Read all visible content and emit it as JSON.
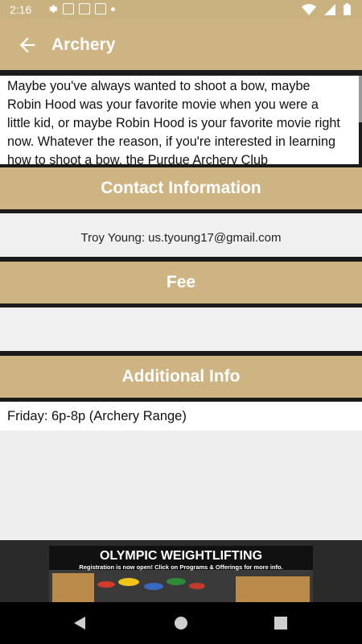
{
  "status_bar": {
    "time": "2:16"
  },
  "app_bar": {
    "title": "Archery",
    "back_icon": "arrow-left-icon"
  },
  "description": "Maybe you've always wanted to shoot a bow, maybe Robin Hood was your favorite movie when you were a little kid, or maybe Robin Hood is your favorite movie right now. Whatever the reason, if you're interested in learning how to shoot a bow, the Purdue Archery Club",
  "sections": {
    "contact": {
      "title": "Contact Information",
      "value": "Troy Young: us.tyoung17@gmail.com"
    },
    "fee": {
      "title": "Fee",
      "value": ""
    },
    "additional": {
      "title": "Additional Info",
      "value": "Friday: 6p-8p (Archery Range)"
    }
  },
  "ad": {
    "title": "OLYMPIC WEIGHTLIFTING",
    "subtitle": "Registration is now open! Click on Programs & Offerings for more info."
  },
  "colors": {
    "brand_gold": "#cfb483",
    "status_bar": "#c9b180"
  }
}
